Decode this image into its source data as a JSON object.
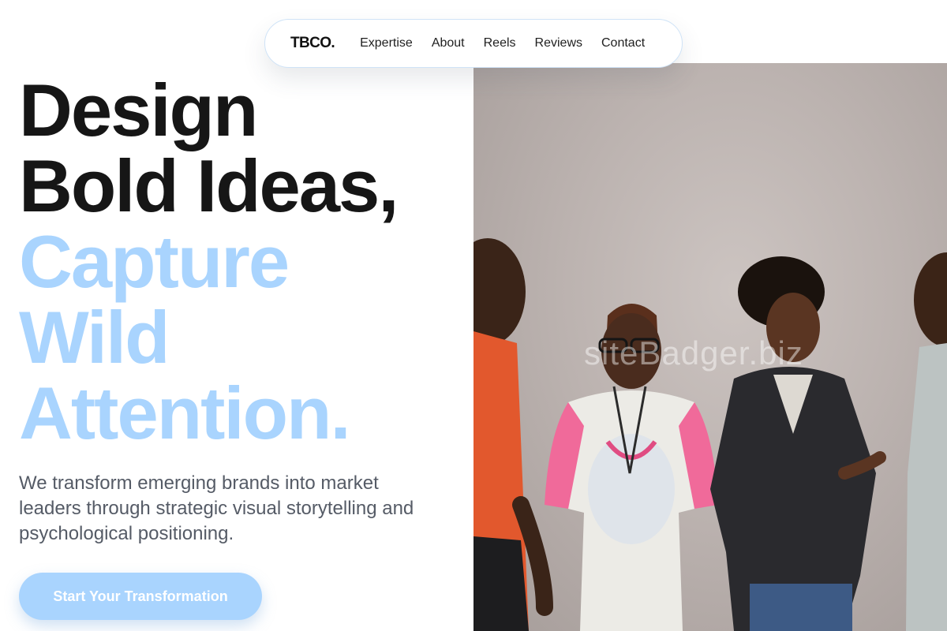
{
  "nav": {
    "logo": "TBCO.",
    "links": [
      "Expertise",
      "About",
      "Reels",
      "Reviews",
      "Contact"
    ]
  },
  "hero": {
    "headline_dark": [
      "Design",
      "Bold Ideas,"
    ],
    "headline_accent": [
      "Capture",
      "Wild",
      "Attention."
    ],
    "subtext": "We transform emerging brands into market leaders through strategic visual storytelling and psychological positioning.",
    "cta_label": "Start Your Transformation",
    "image_watermark": "siteBadger.biz"
  },
  "colors": {
    "accent": "#a9d4fe",
    "headline": "#161616",
    "body_text": "#555b66"
  },
  "icons": {
    "hero_image": "group-of-smiling-people-photo"
  }
}
